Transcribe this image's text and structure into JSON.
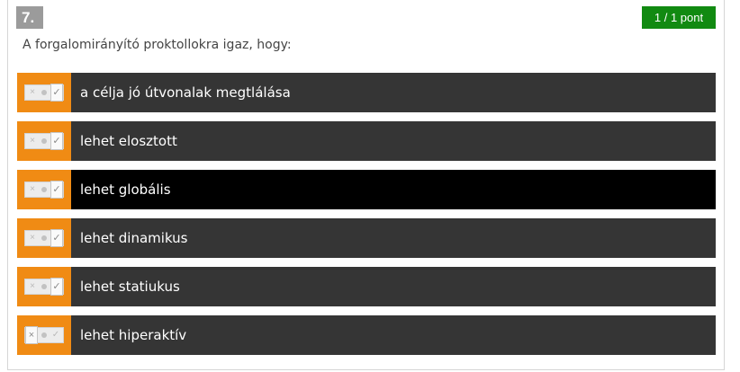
{
  "question": {
    "number": "7.",
    "score": "1 / 1 pont",
    "prompt": "A forgalomirányító proktollokra igaz, hogy:"
  },
  "options": [
    {
      "label": "a célja jó útvonalak megtlálása",
      "state": "yes",
      "highlighted": false
    },
    {
      "label": "lehet elosztott",
      "state": "yes",
      "highlighted": false
    },
    {
      "label": "lehet globális",
      "state": "yes",
      "highlighted": true
    },
    {
      "label": "lehet dinamikus",
      "state": "yes",
      "highlighted": false
    },
    {
      "label": "lehet statiukus",
      "state": "yes",
      "highlighted": false
    },
    {
      "label": "lehet hiperaktív",
      "state": "no",
      "highlighted": false
    }
  ],
  "icons": {
    "cross": "×",
    "check": "✓"
  },
  "colors": {
    "score_badge": "#118a11",
    "question_badge": "#9b9b9b",
    "toggle_strip": "#f08b14",
    "option_bg": "#353535",
    "option_highlight_bg": "#000000"
  }
}
